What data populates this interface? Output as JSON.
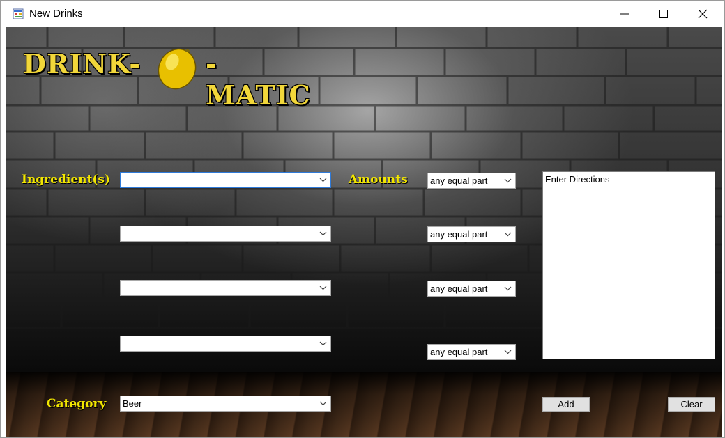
{
  "window": {
    "title": "New Drinks"
  },
  "logo": {
    "text_left": "DRINK-",
    "text_right": "-MATIC",
    "icon": "lemon-icon"
  },
  "labels": {
    "ingredients": "Ingredient(s)",
    "amounts": "Amounts",
    "category": "Category"
  },
  "ingredients": [
    {
      "value": ""
    },
    {
      "value": ""
    },
    {
      "value": ""
    },
    {
      "value": ""
    }
  ],
  "amounts": [
    {
      "value": "any equal part"
    },
    {
      "value": "any equal part"
    },
    {
      "value": "any equal part"
    },
    {
      "value": "any equal part"
    }
  ],
  "category": {
    "value": "Beer"
  },
  "directions": {
    "text": "Enter Directions"
  },
  "buttons": {
    "add": "Add",
    "clear": "Clear"
  },
  "colors": {
    "label_yellow": "#f2e600",
    "logo_gold": "#f2d73a",
    "focus_blue": "#2f7ad8"
  }
}
